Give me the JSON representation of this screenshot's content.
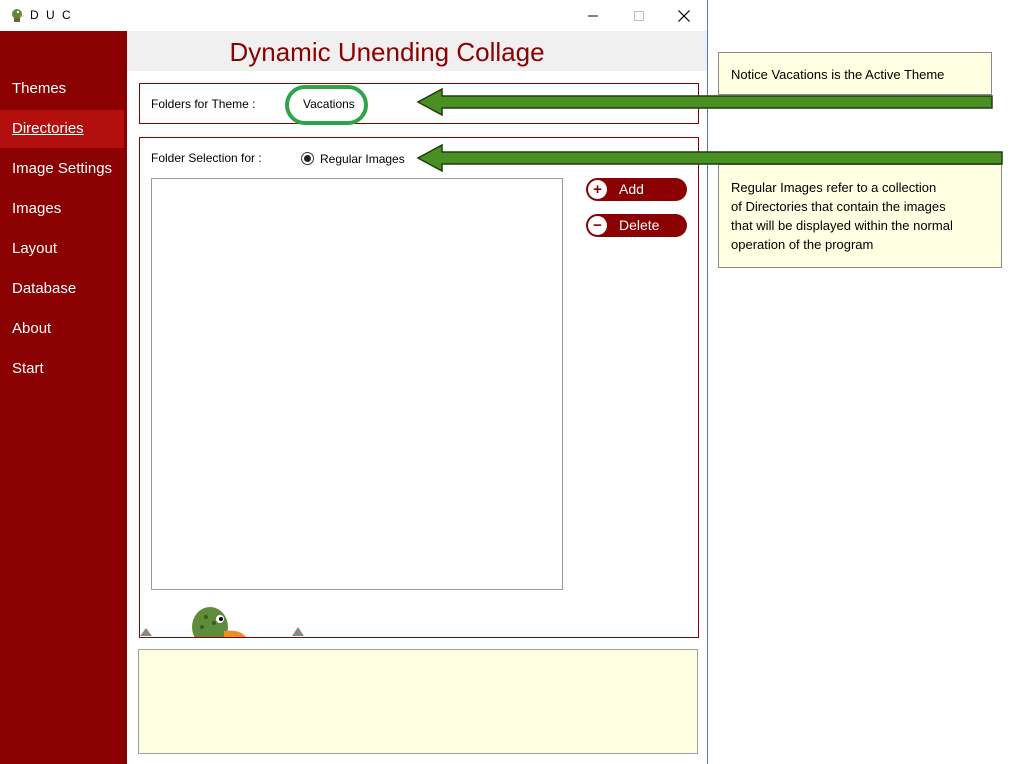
{
  "window": {
    "title": "D U C",
    "controls": [
      "minimize-icon",
      "maximize-icon",
      "close-icon"
    ]
  },
  "sidebar": {
    "items": [
      {
        "label": "Themes"
      },
      {
        "label": "Directories",
        "active": true
      },
      {
        "label": "Image Settings"
      },
      {
        "label": "Images"
      },
      {
        "label": "Layout"
      },
      {
        "label": "Database"
      },
      {
        "label": "About"
      },
      {
        "label": "Start"
      }
    ]
  },
  "header": {
    "title": "Dynamic Unending Collage"
  },
  "theme_panel": {
    "label": "Folders for Theme :",
    "value": "Vacations"
  },
  "folder_panel": {
    "label": "Folder Selection for :",
    "radio_label": "Regular Images",
    "radio_checked": true,
    "add_label": "Add",
    "delete_label": "Delete"
  },
  "callouts": {
    "active_theme": "Notice Vacations is the Active Theme",
    "regular_images": [
      "Regular Images refer to a collection",
      "of Directories that contain the images",
      "that will be displayed within the normal",
      "operation of the program"
    ]
  },
  "colors": {
    "brand": "#8b0000",
    "active_nav": "#b30f0f",
    "highlight": "#2ea34a",
    "arrow": "#4a8f22",
    "note_bg": "#ffffe1"
  }
}
